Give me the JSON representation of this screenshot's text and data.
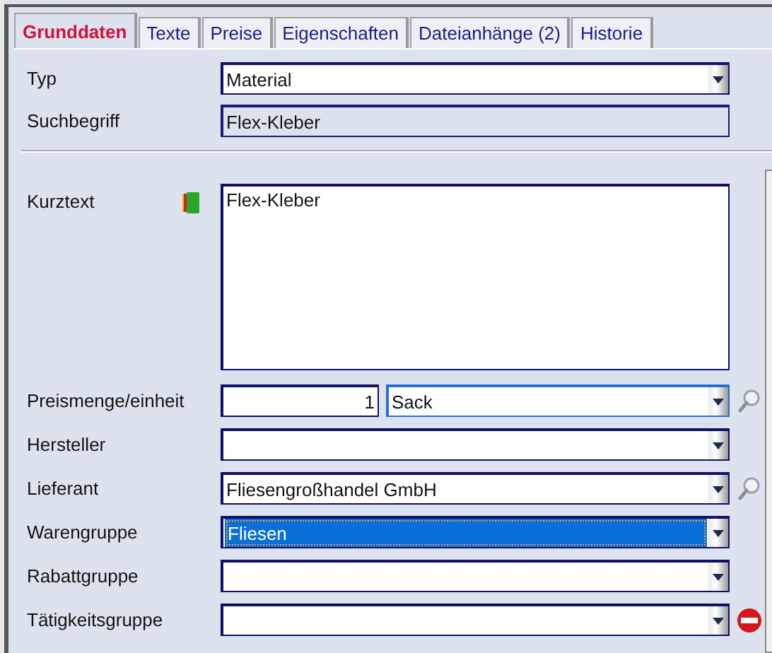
{
  "tabs": [
    {
      "label": "Grunddaten",
      "selected": true
    },
    {
      "label": "Texte",
      "selected": false
    },
    {
      "label": "Preise",
      "selected": false
    },
    {
      "label": "Eigenschaften",
      "selected": false
    },
    {
      "label": "Dateianhänge (2)",
      "selected": false
    },
    {
      "label": "Historie",
      "selected": false
    }
  ],
  "header_fields": [
    {
      "kind": "combo",
      "label": "Typ",
      "value": "Material",
      "readonly": false
    },
    {
      "kind": "text",
      "label": "Suchbegriff",
      "value": "Flex-Kleber",
      "readonly": true
    }
  ],
  "kurztext": {
    "label": "Kurztext",
    "value": "Flex-Kleber"
  },
  "fields": [
    {
      "kind": "qty_unit",
      "label": "Preismenge/einheit",
      "quantity": "1",
      "value": "Sack",
      "highlighted": false,
      "searchable": true,
      "removable": false
    },
    {
      "kind": "combo",
      "label": "Hersteller",
      "highlighted": false,
      "searchable": false,
      "removable": false
    },
    {
      "kind": "combo",
      "label": "Lieferant",
      "value": "Fliesengroßhandel GmbH",
      "highlighted": false,
      "searchable": true,
      "removable": false
    },
    {
      "kind": "combo",
      "label": "Warengruppe",
      "value": "Fliesen",
      "highlighted": true,
      "searchable": false,
      "removable": false
    },
    {
      "kind": "combo",
      "label": "Rabattgruppe",
      "highlighted": false,
      "searchable": false,
      "removable": false
    },
    {
      "kind": "combo",
      "label": "Tätigkeitsgruppe",
      "highlighted": false,
      "searchable": false,
      "removable": true
    }
  ]
}
